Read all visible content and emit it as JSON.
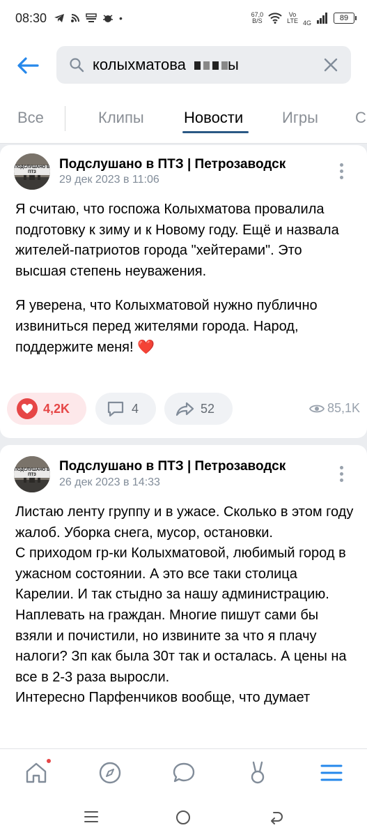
{
  "status_bar": {
    "time": "08:30",
    "speed_value": "67,0",
    "speed_unit": "B/S",
    "network_vo": "Vo",
    "network_lte": "LTE",
    "network_4g": "4G",
    "battery": "89"
  },
  "header": {
    "search_query": "колыхматова ",
    "icons": [
      "back-arrow-icon",
      "search-icon",
      "close-icon"
    ]
  },
  "tabs": [
    {
      "label": "Все",
      "active": false
    },
    {
      "label": "Клипы",
      "active": false
    },
    {
      "label": "Новости",
      "active": true
    },
    {
      "label": "Игры",
      "active": false
    },
    {
      "label": "С",
      "active": false
    }
  ],
  "posts": [
    {
      "author": "Подслушано в ПТЗ | Петрозаводск",
      "avatar_text": "ПОДСЛУШАНО В ПТЗ",
      "date": "29 дек 2023 в 11:06",
      "paragraphs": [
        "Я считаю, что госпожа Колыхматова провалила подготовку к зиму и к Новому году. Ещё и назвала жителей-патриотов города \"хейтерами\". Это высшая степень неуважения.",
        "Я уверена, что Колыхматовой нужно публично извиниться перед жителями города. Народ, поддержите меня! ❤️"
      ],
      "likes": "4,2K",
      "comments": "4",
      "shares": "52",
      "views": "85,1K"
    },
    {
      "author": "Подслушано в ПТЗ | Петрозаводск",
      "avatar_text": "ПОДСЛУШАНО В ПТЗ",
      "date": "26 дек 2023 в 14:33",
      "lines": [
        "Листаю ленту группу и в ужасе. Сколько в этом году жалоб. Уборка снега, мусор, остановки.",
        "С приходом гр-ки Колыхматовой, любимый город в ужасном состоянии. А это все таки столица Карелии. И так стыдно за нашу администрацию. Наплевать на граждан. Многие пишут сами бы взяли и почистили, но извините за что я плачу налоги? Зп как была 30т так и осталась. А цены на все в 2-3 раза выросли.",
        "Интересно Парфенчиков вообще, что думает"
      ]
    }
  ],
  "bottom_nav": [
    "home-icon",
    "discover-icon",
    "messages-icon",
    "clips-icon",
    "menu-icon"
  ],
  "colors": {
    "accent": "#2a5885",
    "like": "#e64646",
    "background": "#ebedf0"
  }
}
